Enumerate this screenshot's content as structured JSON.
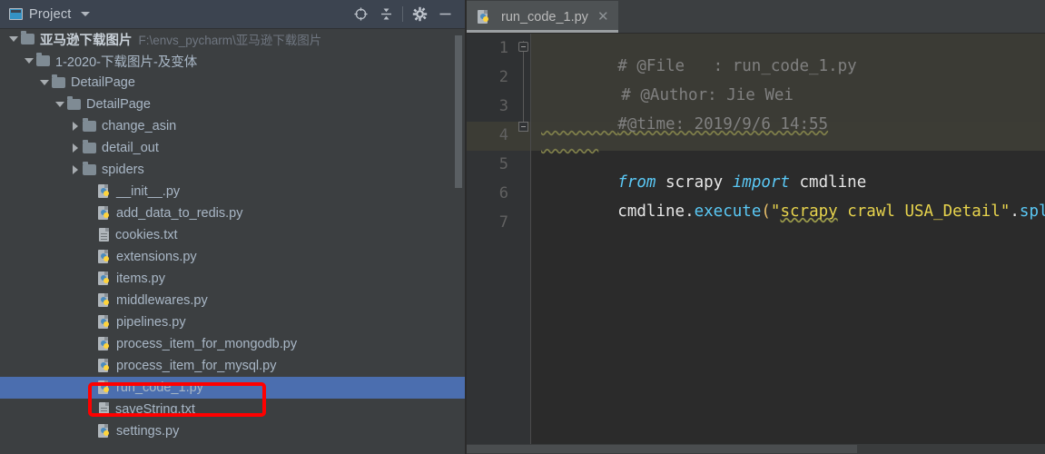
{
  "project_panel": {
    "header": {
      "title": "Project",
      "window_icon": "project-window-icon",
      "dropdown_icon": "chevron-down-icon",
      "buttons": [
        {
          "name": "locate-target-icon",
          "label": "Select Opened File"
        },
        {
          "name": "collapse-all-icon",
          "label": "Collapse All"
        },
        {
          "name": "gear-icon",
          "label": "Settings"
        },
        {
          "name": "hide-icon",
          "label": "Hide"
        }
      ]
    },
    "tree": [
      {
        "indent": 0,
        "arrow": "down",
        "icon": "folder",
        "label": "亚马逊下载图片",
        "bold": true,
        "hint": "F:\\envs_pycharm\\亚马逊下载图片",
        "selected": false
      },
      {
        "indent": 1,
        "arrow": "down",
        "icon": "folder",
        "label": "1-2020-下载图片-及变体",
        "bold": false,
        "hint": "",
        "selected": false
      },
      {
        "indent": 2,
        "arrow": "down",
        "icon": "folder",
        "label": "DetailPage",
        "bold": false,
        "hint": "",
        "selected": false
      },
      {
        "indent": 3,
        "arrow": "down",
        "icon": "folder",
        "label": "DetailPage",
        "bold": false,
        "hint": "",
        "selected": false
      },
      {
        "indent": 4,
        "arrow": "right",
        "icon": "folder",
        "label": "change_asin",
        "bold": false,
        "hint": "",
        "selected": false
      },
      {
        "indent": 4,
        "arrow": "right",
        "icon": "folder",
        "label": "detail_out",
        "bold": false,
        "hint": "",
        "selected": false
      },
      {
        "indent": 4,
        "arrow": "right",
        "icon": "folder",
        "label": "spiders",
        "bold": false,
        "hint": "",
        "selected": false
      },
      {
        "indent": 5,
        "arrow": "none",
        "icon": "python",
        "label": "__init__.py",
        "bold": false,
        "hint": "",
        "selected": false
      },
      {
        "indent": 5,
        "arrow": "none",
        "icon": "python",
        "label": "add_data_to_redis.py",
        "bold": false,
        "hint": "",
        "selected": false
      },
      {
        "indent": 5,
        "arrow": "none",
        "icon": "text",
        "label": "cookies.txt",
        "bold": false,
        "hint": "",
        "selected": false
      },
      {
        "indent": 5,
        "arrow": "none",
        "icon": "python",
        "label": "extensions.py",
        "bold": false,
        "hint": "",
        "selected": false
      },
      {
        "indent": 5,
        "arrow": "none",
        "icon": "python",
        "label": "items.py",
        "bold": false,
        "hint": "",
        "selected": false
      },
      {
        "indent": 5,
        "arrow": "none",
        "icon": "python",
        "label": "middlewares.py",
        "bold": false,
        "hint": "",
        "selected": false
      },
      {
        "indent": 5,
        "arrow": "none",
        "icon": "python",
        "label": "pipelines.py",
        "bold": false,
        "hint": "",
        "selected": false
      },
      {
        "indent": 5,
        "arrow": "none",
        "icon": "python",
        "label": "process_item_for_mongodb.py",
        "bold": false,
        "hint": "",
        "selected": false
      },
      {
        "indent": 5,
        "arrow": "none",
        "icon": "python",
        "label": "process_item_for_mysql.py",
        "bold": false,
        "hint": "",
        "selected": false
      },
      {
        "indent": 5,
        "arrow": "none",
        "icon": "python",
        "label": "run_code_1.py",
        "bold": false,
        "hint": "",
        "selected": true
      },
      {
        "indent": 5,
        "arrow": "none",
        "icon": "text",
        "label": "saveString.txt",
        "bold": false,
        "hint": "",
        "selected": false
      },
      {
        "indent": 5,
        "arrow": "none",
        "icon": "python",
        "label": "settings.py",
        "bold": false,
        "hint": "",
        "selected": false
      }
    ],
    "selection_color": "#4b6eaf",
    "scrollbar": "vertical-scrollbar"
  },
  "editor": {
    "tab": {
      "label": "run_code_1.py",
      "file_icon": "python-file-icon",
      "close_icon": "close-icon"
    },
    "line_numbers": [
      "1",
      "2",
      "3",
      "4",
      "5",
      "6",
      "7"
    ],
    "caret_line": 4,
    "fold_markers": [
      "fold-minus-icon",
      "fold-minus-icon"
    ],
    "lines": [
      {
        "n": 1,
        "text": "# @File   : run_code_1.py"
      },
      {
        "n": 2,
        "text": "# @Author: Jie Wei"
      },
      {
        "n": 3,
        "text": "#@time: 2019/9/6 14:55"
      },
      {
        "n": 4,
        "text": ""
      },
      {
        "n": 5,
        "text": "from scrapy import cmdline"
      },
      {
        "n": 6,
        "text": "cmdline.execute(\"scrapy crawl USA_Detail\".split"
      },
      {
        "n": 7,
        "text": ""
      }
    ],
    "tokens": {
      "l1_comment": "# @File   : run_code_1.py",
      "l2_comment": "# @Author: Jie Wei",
      "l3_comment": "#@time: 2019/9/6 14:55",
      "l5_from": "from",
      "l5_mod": " scrapy ",
      "l5_import": "import",
      "l5_name": " cmdline",
      "l6_obj": "cmdline",
      "l6_dot": ".",
      "l6_func": "execute",
      "l6_open": "(",
      "l6_quote": "\"",
      "l6_scrapy": "scrapy",
      "l6_rest": " crawl USA_Detail",
      "l6_quote2": "\"",
      "l6_dot2": ".",
      "l6_split": "split"
    },
    "colors": {
      "background": "#2b2b2b",
      "gutter": "#313335",
      "comment_block": "#3b3b35",
      "caret_line": "#3c3c35",
      "keyword": "#5ac8f5",
      "string": "#e8d44d",
      "comment": "#808080"
    },
    "hscrollbar": "horizontal-scrollbar"
  },
  "annotation": {
    "type": "red-highlight-rectangle",
    "targets": "run_code_1.py",
    "color": "#ff0000"
  }
}
